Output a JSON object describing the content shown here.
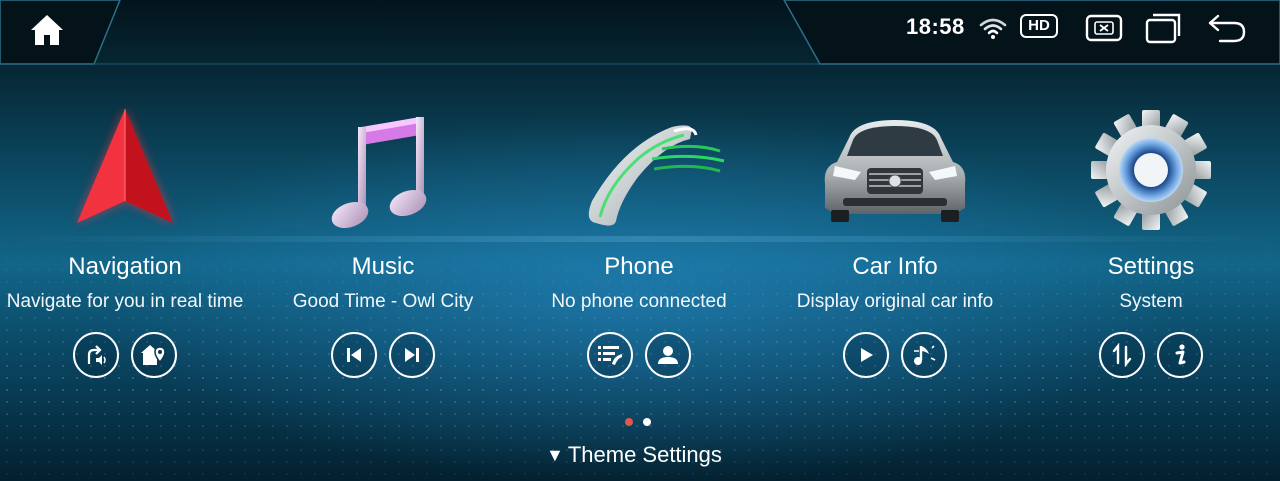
{
  "status_bar": {
    "time": "18:58",
    "hd_label": "HD",
    "icons": [
      "home-icon",
      "wifi-icon",
      "close-window-icon",
      "multi-window-icon",
      "back-icon"
    ]
  },
  "apps": [
    {
      "title": "Navigation",
      "subtitle": "Navigate for you in real time",
      "icon": "navigation-arrow-icon",
      "actions": [
        "voice-navigation-icon",
        "home-location-icon"
      ]
    },
    {
      "title": "Music",
      "subtitle": "Good Time - Owl City",
      "icon": "music-note-icon",
      "actions": [
        "previous-track-icon",
        "next-track-icon"
      ]
    },
    {
      "title": "Phone",
      "subtitle": "No phone connected",
      "icon": "phone-handset-icon",
      "actions": [
        "call-log-icon",
        "contacts-icon"
      ]
    },
    {
      "title": "Car Info",
      "subtitle": "Display original car info",
      "icon": "car-icon",
      "actions": [
        "play-icon",
        "car-audio-icon"
      ]
    },
    {
      "title": "Settings",
      "subtitle": "System",
      "icon": "gear-icon",
      "actions": [
        "sort-icon",
        "info-icon"
      ]
    }
  ],
  "pager": {
    "pages": 2,
    "active": 1,
    "active_color": "#e0584f",
    "inactive_color": "#ffffff"
  },
  "theme_settings": {
    "label": "Theme Settings",
    "arrow": "▼"
  },
  "colors": {
    "accent_red": "#e8212f",
    "bg_top": "#03141c",
    "bg_glow": "#12668a"
  }
}
